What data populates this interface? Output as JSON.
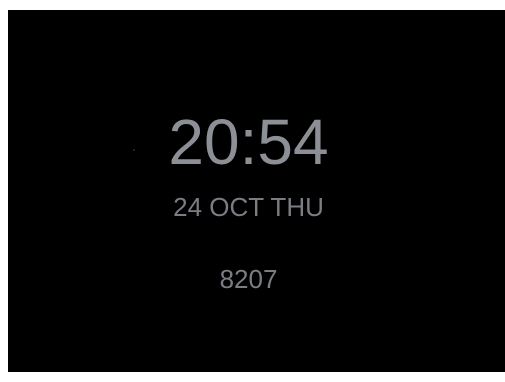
{
  "display": {
    "time": "20:54",
    "date": "24 OCT THU",
    "steps": "8207"
  },
  "colors": {
    "background": "#000000",
    "time_text": "#8c8f95",
    "secondary_text": "#7a7d83"
  }
}
